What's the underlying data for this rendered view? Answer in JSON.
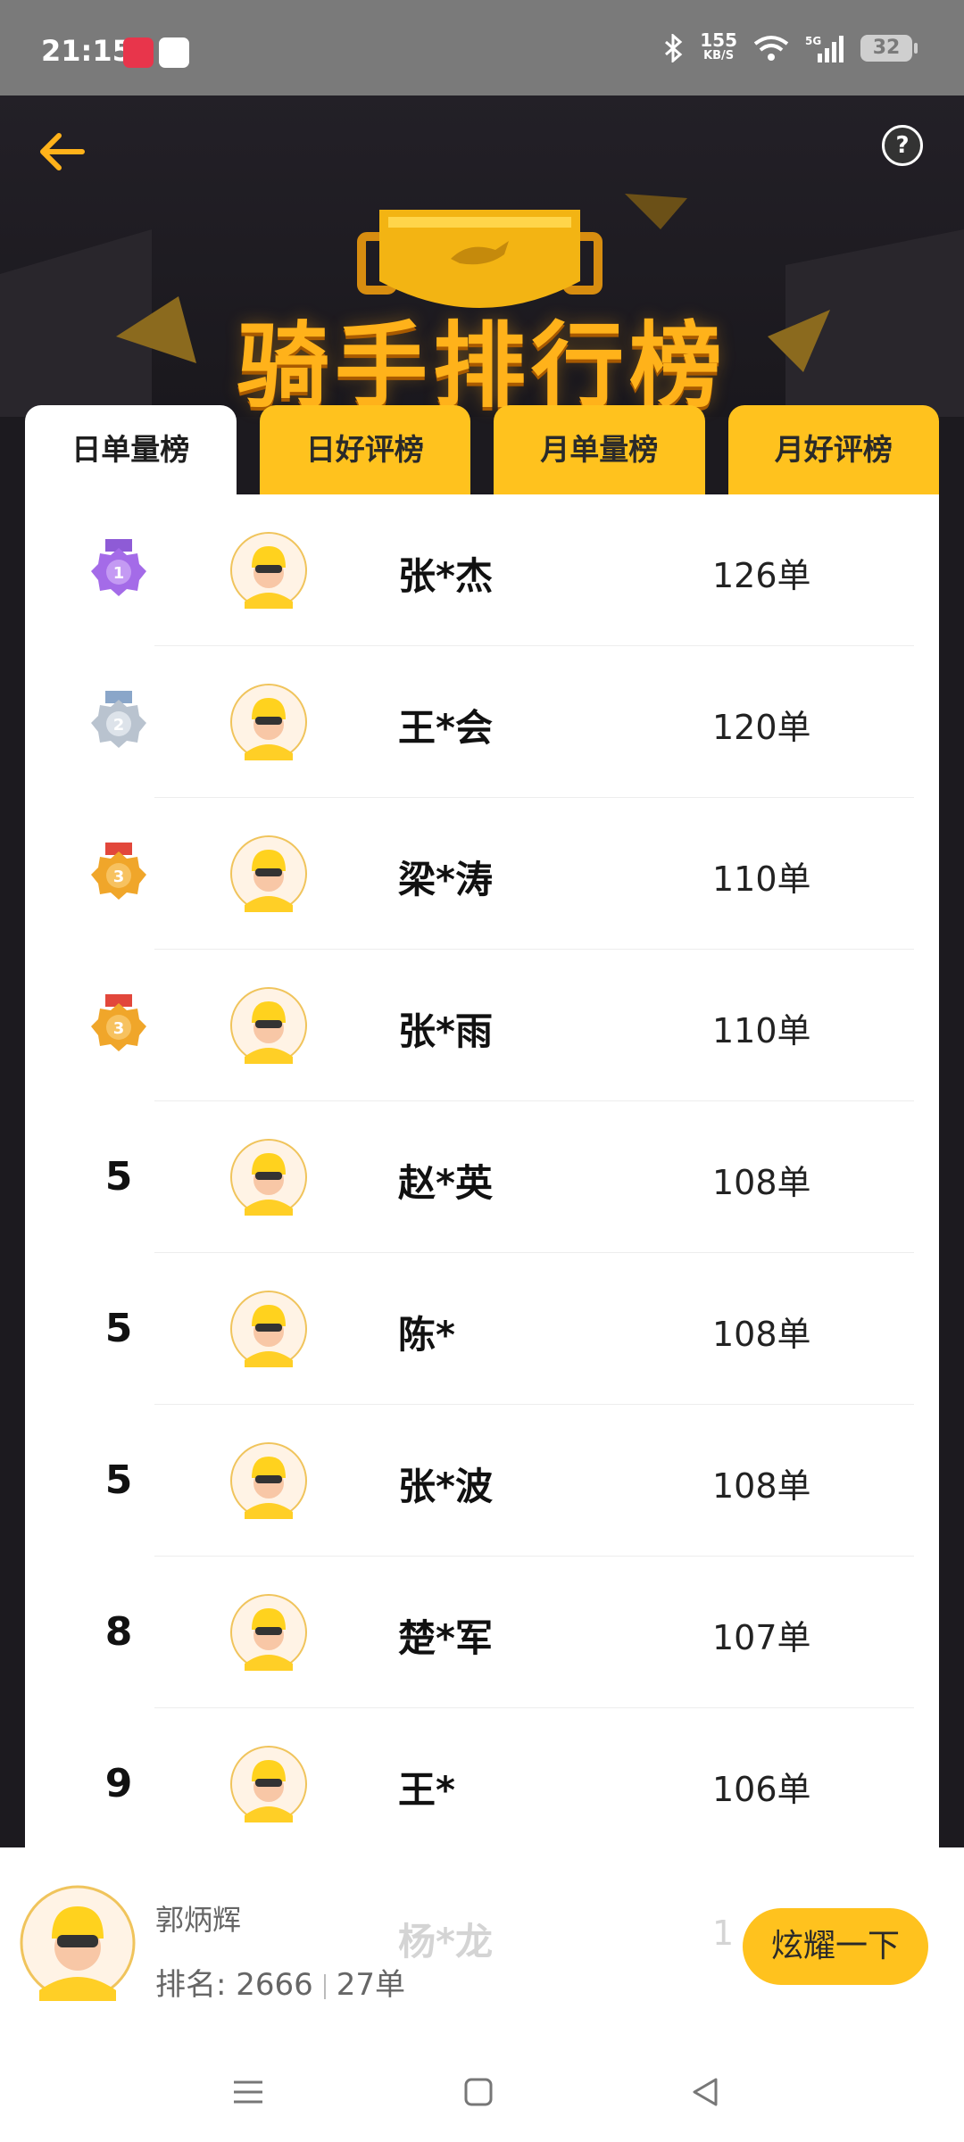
{
  "status": {
    "time": "21:15",
    "speed_value": "155",
    "speed_unit": "KB/S",
    "battery": "32"
  },
  "header": {
    "title": "骑手排行榜",
    "help_glyph": "?"
  },
  "tabs": [
    {
      "label": "日单量榜",
      "active": true
    },
    {
      "label": "日好评榜",
      "active": false
    },
    {
      "label": "月单量榜",
      "active": false
    },
    {
      "label": "月好评榜",
      "active": false
    }
  ],
  "rows": [
    {
      "rank": "1",
      "medal": "purple",
      "name": "张*杰",
      "count": "126单"
    },
    {
      "rank": "2",
      "medal": "silver",
      "name": "王*会",
      "count": "120单"
    },
    {
      "rank": "3",
      "medal": "bronze",
      "name": "梁*涛",
      "count": "110单"
    },
    {
      "rank": "3",
      "medal": "bronze",
      "name": "张*雨",
      "count": "110单"
    },
    {
      "rank": "5",
      "medal": "",
      "name": "赵*英",
      "count": "108单"
    },
    {
      "rank": "5",
      "medal": "",
      "name": "陈*",
      "count": "108单"
    },
    {
      "rank": "5",
      "medal": "",
      "name": "张*波",
      "count": "108单"
    },
    {
      "rank": "8",
      "medal": "",
      "name": "楚*军",
      "count": "107单"
    },
    {
      "rank": "9",
      "medal": "",
      "name": "王*",
      "count": "106单"
    },
    {
      "rank": "",
      "medal": "",
      "name": "杨*龙",
      "count": "1"
    }
  ],
  "me": {
    "name": "郭炳辉",
    "rank_label": "排名: 2666",
    "count": "27单",
    "button": "炫耀一下"
  },
  "colors": {
    "accent": "#ffc21e",
    "title_gold": "#ffb21a",
    "dark_bg": "#1c1a1f"
  }
}
